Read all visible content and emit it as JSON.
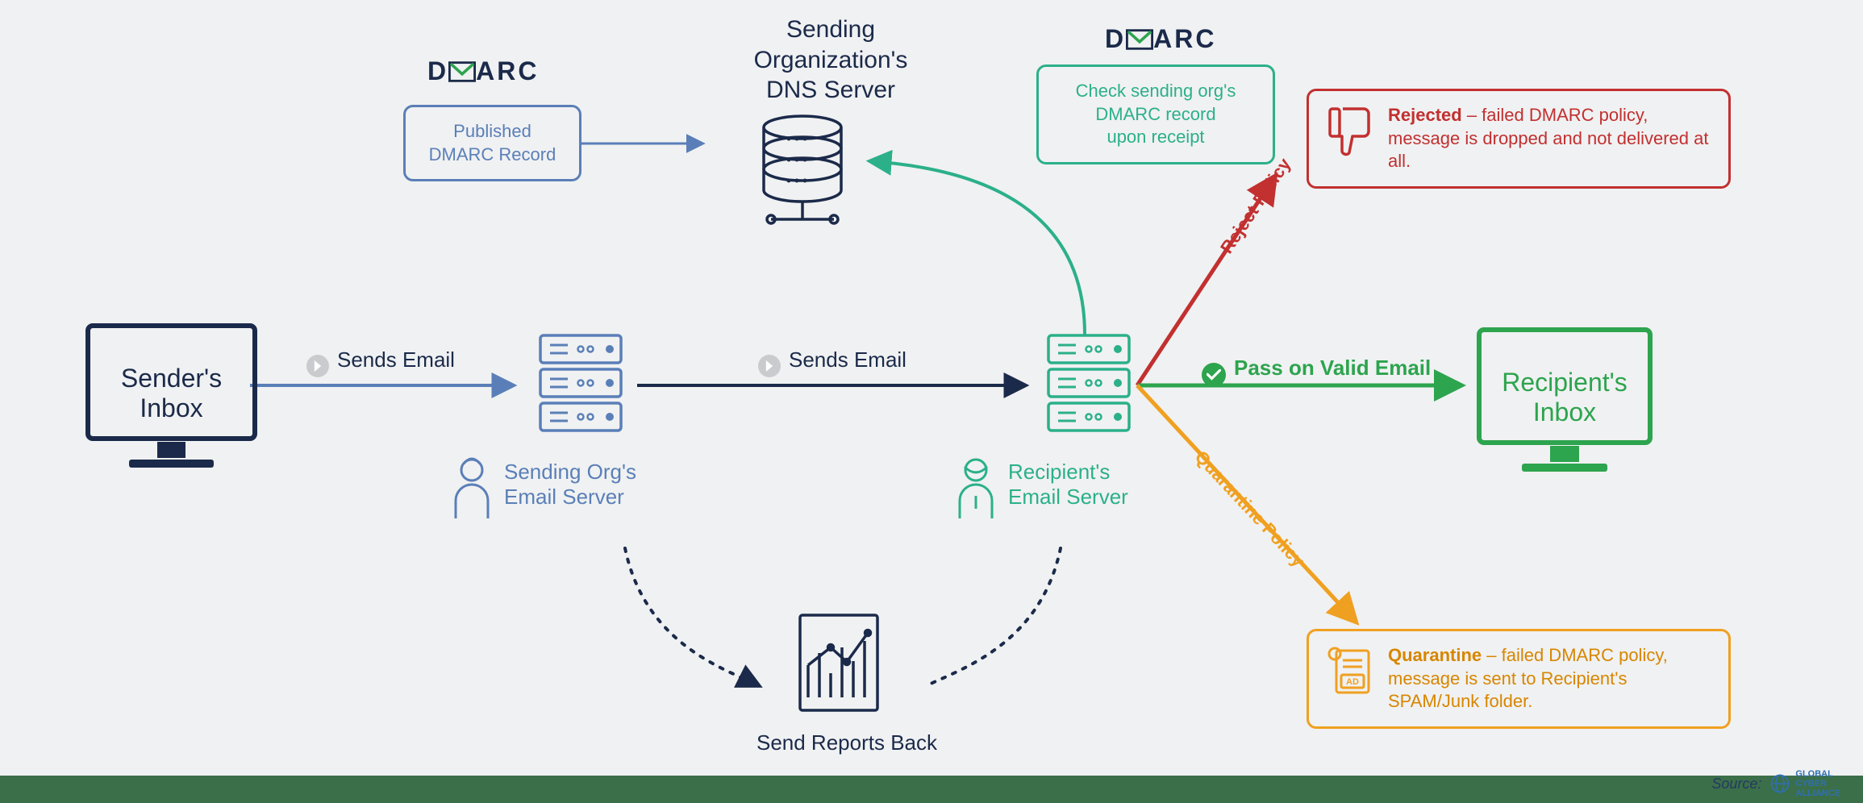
{
  "colors": {
    "navy": "#1b2a4a",
    "blue": "#5a7fb8",
    "green": "#2da44e",
    "teal": "#2bb08a",
    "red": "#c23030",
    "orange": "#f0a020"
  },
  "dmarc_brand": "DMARC",
  "nodes": {
    "sender_inbox": "Sender's\nInbox",
    "recipient_inbox": "Recipient's\nInbox",
    "sending_server": "Sending Org's\nEmail Server",
    "recipient_server": "Recipient's\nEmail Server",
    "dns_server": "Sending\nOrganization's\nDNS Server",
    "reports": "Send Reports Back"
  },
  "boxes": {
    "published_record": "Published\nDMARC Record",
    "check_record": "Check sending org's\nDMARC record\nupon receipt",
    "rejected_bold": "Rejected",
    "rejected_rest": " – failed DMARC policy, message is dropped and not delivered at all.",
    "quarantine_bold": "Quarantine",
    "quarantine_rest": " – failed DMARC policy, message is sent to Recipient's SPAM/Junk folder."
  },
  "edges": {
    "sends_email": "Sends Email",
    "pass_valid": "Pass on Valid Email",
    "reject_policy": "Reject Policy",
    "quarantine_policy": "Quarantine Policy"
  },
  "footer": {
    "source_label": "Source:",
    "gca": "GLOBAL CYBER ALLIANCE"
  }
}
